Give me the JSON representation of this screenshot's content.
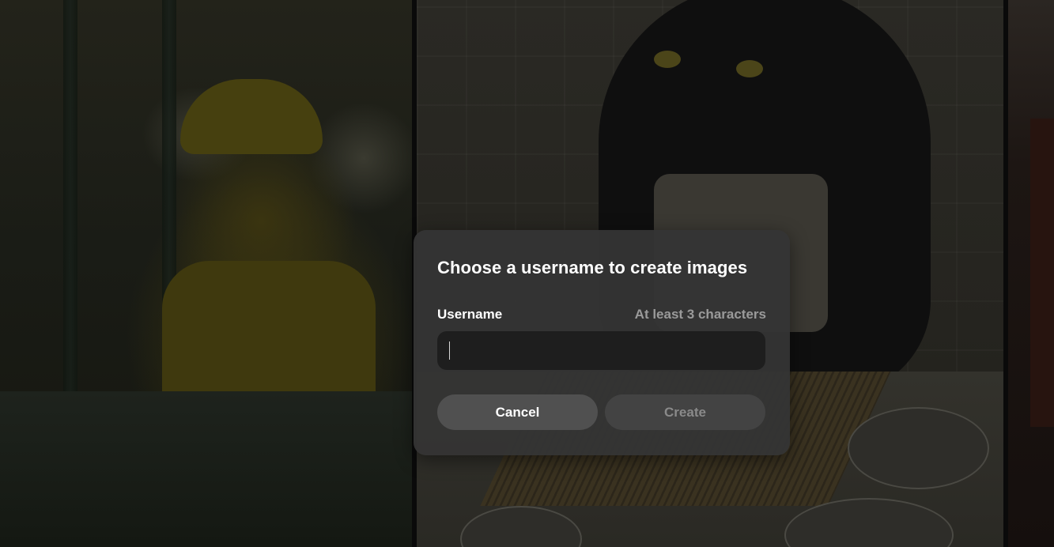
{
  "dialog": {
    "title": "Choose a username to create images",
    "username_label": "Username",
    "username_hint": "At least 3 characters",
    "username_value": "",
    "username_placeholder": "",
    "cancel_label": "Cancel",
    "create_label": "Create",
    "create_disabled": true
  },
  "background": {
    "panels": [
      {
        "subject": "koala wearing yellow cap and shirt at counter"
      },
      {
        "subject": "black cat in apron preparing sushi in kitchen"
      },
      {
        "subject": "partial dark reddish interior"
      }
    ]
  },
  "colors": {
    "modal_bg": "#343434",
    "input_bg": "#1e1e1e",
    "cancel_bg": "#505050",
    "create_bg": "#434343",
    "hint_text": "#9a9a9a"
  }
}
